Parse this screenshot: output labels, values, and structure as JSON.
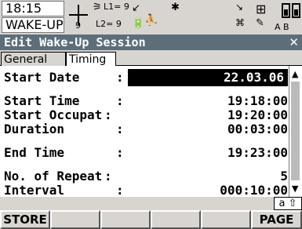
{
  "status": {
    "time": "18:15",
    "mode": "WAKE-UP",
    "satellites": "9",
    "l1": "L1= 9",
    "l2": "L2= 9",
    "input_mode": "A B"
  },
  "title": "Edit Wake-Up Session",
  "tabs": [
    {
      "label": "General"
    },
    {
      "label": "Timing"
    }
  ],
  "fields": [
    {
      "label": "Start Date",
      "value": "22.03.06"
    },
    {
      "label": "Start Time",
      "value": "19:18:00"
    },
    {
      "label": "Start Occupat",
      "value": "19:20:00"
    },
    {
      "label": "Duration",
      "value": "00:03:00"
    },
    {
      "label": "End Time",
      "value": "19:23:00"
    },
    {
      "label": "No. of Repeat",
      "value": "5"
    },
    {
      "label": "Interval",
      "value": "000:10:00"
    }
  ],
  "input_state": "a ⇧",
  "fkeys": [
    {
      "label": "STORE"
    },
    {
      "label": ""
    },
    {
      "label": ""
    },
    {
      "label": ""
    },
    {
      "label": ""
    },
    {
      "label": "PAGE"
    }
  ]
}
